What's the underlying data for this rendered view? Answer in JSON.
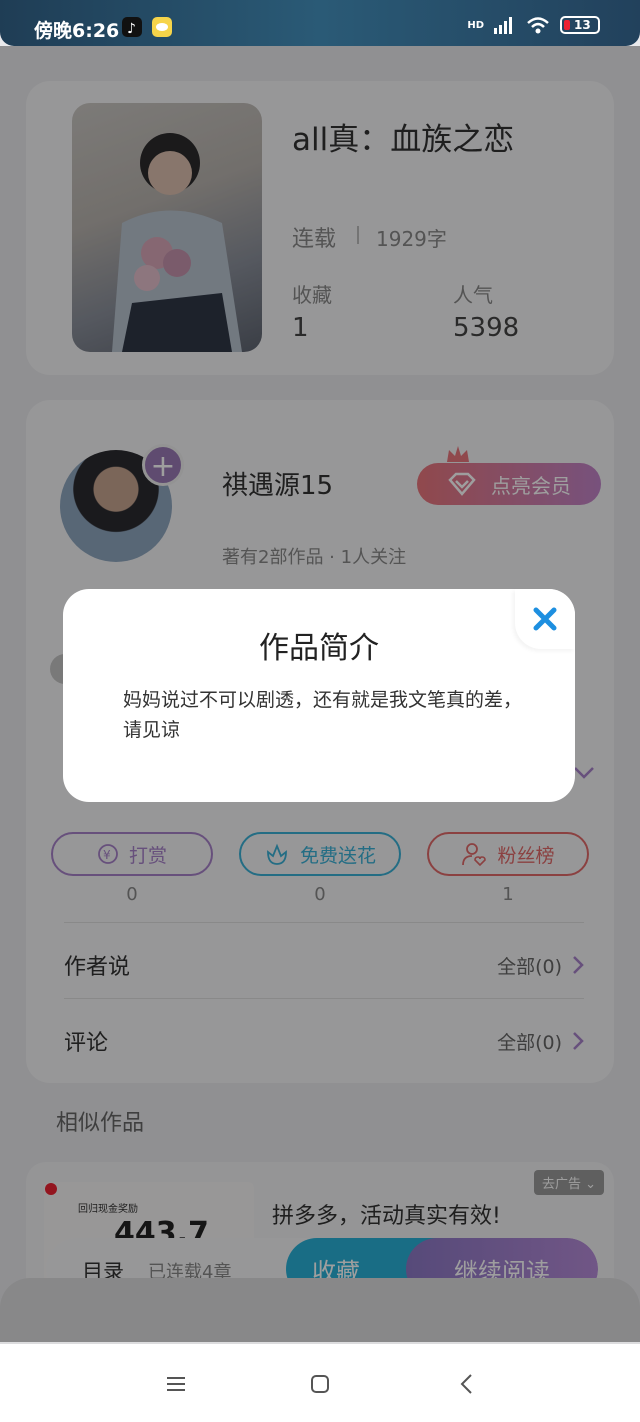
{
  "status_bar": {
    "time": "傍晚6:26",
    "network": "HD",
    "battery": "13"
  },
  "book": {
    "title": "all真：血族之恋",
    "status": "连载",
    "words": "1929字",
    "favorites_label": "收藏",
    "favorites_value": "1",
    "popularity_label": "人气",
    "popularity_value": "5398"
  },
  "author": {
    "name": "祺遇源15",
    "meta": "著有2部作品 · 1人关注",
    "vip_button": "点亮会员",
    "follow_symbol": "+"
  },
  "actions": [
    {
      "label": "打赏",
      "count": "0",
      "color": "#a681c9"
    },
    {
      "label": "免费送花",
      "count": "0",
      "color": "#3ab0d6"
    },
    {
      "label": "粉丝榜",
      "count": "1",
      "color": "#e06a6a"
    }
  ],
  "rows": [
    {
      "title": "作者说",
      "more": "全部(0)"
    },
    {
      "title": "评论",
      "more": "全部(0)"
    }
  ],
  "similar_title": "相似作品",
  "ad": {
    "text": "拼多多，活动真实有效!",
    "tag": "去广告",
    "image_caption": "回归现金奖励",
    "image_amount": "443.7"
  },
  "bottom_bar": {
    "toc": "目录",
    "toc_sub": "已连载4章",
    "favorite": "收藏",
    "continue": "继续阅读"
  },
  "modal": {
    "title": "作品简介",
    "body": "妈妈说过不可以剧透，还有就是我文笔真的差，请见谅"
  },
  "colors": {
    "accent_blue": "#29b1d7",
    "accent_purple": "#9a7ab5"
  }
}
